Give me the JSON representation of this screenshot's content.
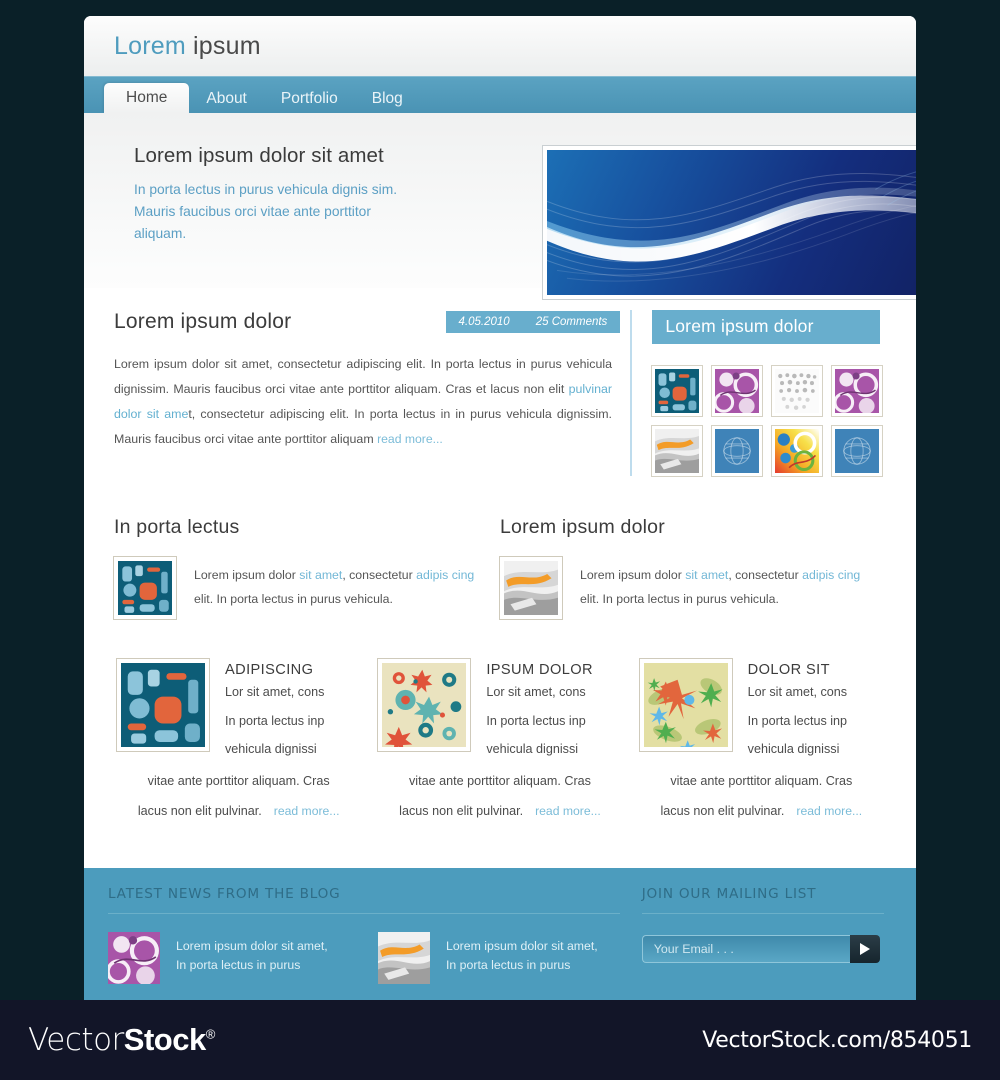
{
  "site": {
    "logo_primary": "Lorem",
    "logo_secondary": "ipsum"
  },
  "nav": {
    "items": [
      {
        "label": "Home",
        "active": true
      },
      {
        "label": "About",
        "active": false
      },
      {
        "label": "Portfolio",
        "active": false
      },
      {
        "label": "Blog",
        "active": false
      }
    ]
  },
  "hero": {
    "title": "Lorem ipsum dolor sit amet",
    "subtitle": "In porta lectus in purus vehicula dignis sim. Mauris faucibus orci vitae ante porttitor aliquam.",
    "banner_alt": "blue-wave-banner"
  },
  "article": {
    "title": "Lorem ipsum dolor",
    "date": "4.05.2010",
    "comments": "25 Comments",
    "body_part1": "Lorem ipsum dolor sit amet, consectetur adipiscing elit. In porta lectus in purus vehicula dignissim. Mauris faucibus orci vitae ante porttitor aliquam. Cras et lacus non elit ",
    "body_link": "pulvinar dolor sit ame",
    "body_part2": "t, consectetur adipiscing elit. In porta lectus in  in purus vehicula dignissim. Mauris faucibus orci vitae ante porttitor aliquam",
    "read_more": "read more..."
  },
  "sidebar": {
    "title": "Lorem ipsum dolor",
    "thumbnails": [
      {
        "name": "thumb-retro-blocks",
        "art": "retro"
      },
      {
        "name": "thumb-purple-circles",
        "art": "purple"
      },
      {
        "name": "thumb-grey-dots",
        "art": "dots"
      },
      {
        "name": "thumb-purple-circles-2",
        "art": "purple"
      },
      {
        "name": "thumb-silver-swoosh",
        "art": "silver"
      },
      {
        "name": "thumb-blue-globe",
        "art": "globe"
      },
      {
        "name": "thumb-rainbow-circles",
        "art": "rainbow"
      },
      {
        "name": "thumb-blue-globe-2",
        "art": "globe"
      }
    ]
  },
  "duo": [
    {
      "heading": "In porta lectus",
      "thumb": "retro",
      "text_a": "Lorem ipsum dolor ",
      "link_a": "sit amet",
      "text_b": ", consectetur ",
      "link_b": "adipis cing",
      "text_c": " elit. In porta lectus in purus vehicula."
    },
    {
      "heading": "Lorem ipsum dolor",
      "thumb": "silver",
      "text_a": "Lorem ipsum dolor ",
      "link_a": "sit amet",
      "text_b": ", consectetur ",
      "link_b": "adipis cing",
      "text_c": " elit. In porta lectus in purus vehicula."
    }
  ],
  "cards": [
    {
      "heading": "ADIPISCING",
      "thumb": "retro",
      "line1": "Lor sit amet, cons",
      "line2": "In porta lectus inp",
      "line3": "vehicula dignissi",
      "line4": "vitae ante porttitor aliquam. Cras",
      "line5": "lacus non elit pulvinar.",
      "read_more": "read more..."
    },
    {
      "heading": "IPSUM DOLOR",
      "thumb": "floral-cream",
      "line1": "Lor sit amet, cons",
      "line2": "In porta lectus inp",
      "line3": "vehicula dignissi",
      "line4": "vitae ante porttitor aliquam. Cras",
      "line5": "lacus non elit pulvinar.",
      "read_more": "read more..."
    },
    {
      "heading": "DOLOR SIT",
      "thumb": "floral-green",
      "line1": "Lor sit amet, cons",
      "line2": "In porta lectus inp",
      "line3": "vehicula dignissi",
      "line4": "vitae ante porttitor aliquam. Cras",
      "line5": "lacus non elit pulvinar.",
      "read_more": "read more..."
    }
  ],
  "footer": {
    "blog_heading": "LATEST NEWS FROM THE BLOG",
    "mailing_heading": "JOIN OUR MAILING LIST",
    "news": [
      {
        "thumb": "purple",
        "text_line1": "Lorem ipsum dolor sit amet,",
        "text_line2": "In porta lectus in purus"
      },
      {
        "thumb": "silver",
        "text_line1": "Lorem ipsum dolor sit amet,",
        "text_line2": "In porta lectus in purus"
      }
    ],
    "email_placeholder": "Your Email . . .",
    "email_value": "",
    "submit_icon": "play-arrow-icon"
  },
  "watermark": {
    "brand_light": "Vector",
    "brand_bold": "Stock",
    "registered": "®",
    "url": "VectorStock.com/854051"
  },
  "colors": {
    "accent_blue": "#4c9cbd",
    "link_blue": "#63b0d0",
    "page_bg": "#0a2028",
    "watermark_bg": "#121528"
  }
}
